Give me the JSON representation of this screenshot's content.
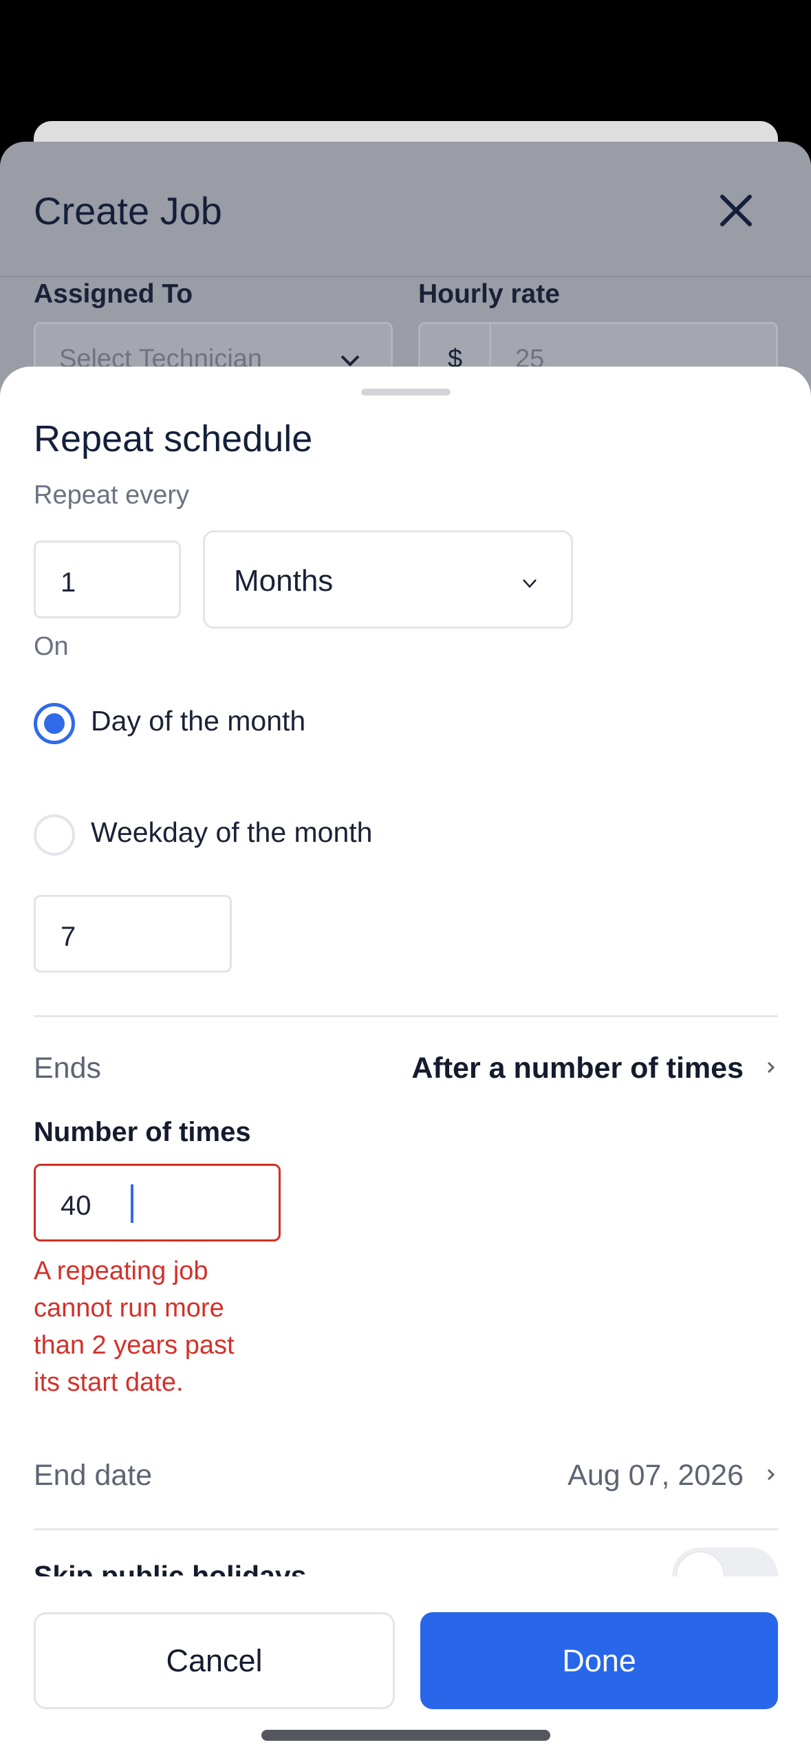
{
  "background": {
    "title": "Create Job",
    "assigned_to_label": "Assigned To",
    "technician_placeholder": "Select Technician",
    "hourly_rate_label": "Hourly rate",
    "currency_symbol": "$",
    "hourly_rate_placeholder": "25"
  },
  "modal": {
    "title": "Repeat schedule",
    "repeat_every_label": "Repeat every",
    "repeat_interval": "1",
    "repeat_unit": "Months",
    "on_label": "On",
    "options": [
      {
        "label": "Day of the month",
        "selected": true
      },
      {
        "label": "Weekday of the month",
        "selected": false
      }
    ],
    "day_value": "7",
    "ends_label": "Ends",
    "ends_value": "After a number of times",
    "number_of_times_label": "Number of times",
    "number_of_times_value": "40",
    "error_message": "A repeating job cannot run more than 2 years past its start date.",
    "end_date_label": "End date",
    "end_date_value": "Aug 07, 2026",
    "skip_holidays_label": "Skip public holidays",
    "skip_holidays_on": false
  },
  "footer": {
    "cancel_label": "Cancel",
    "done_label": "Done"
  },
  "colors": {
    "accent": "#2866ea",
    "error": "#d3312a",
    "text": "#141b2e"
  }
}
